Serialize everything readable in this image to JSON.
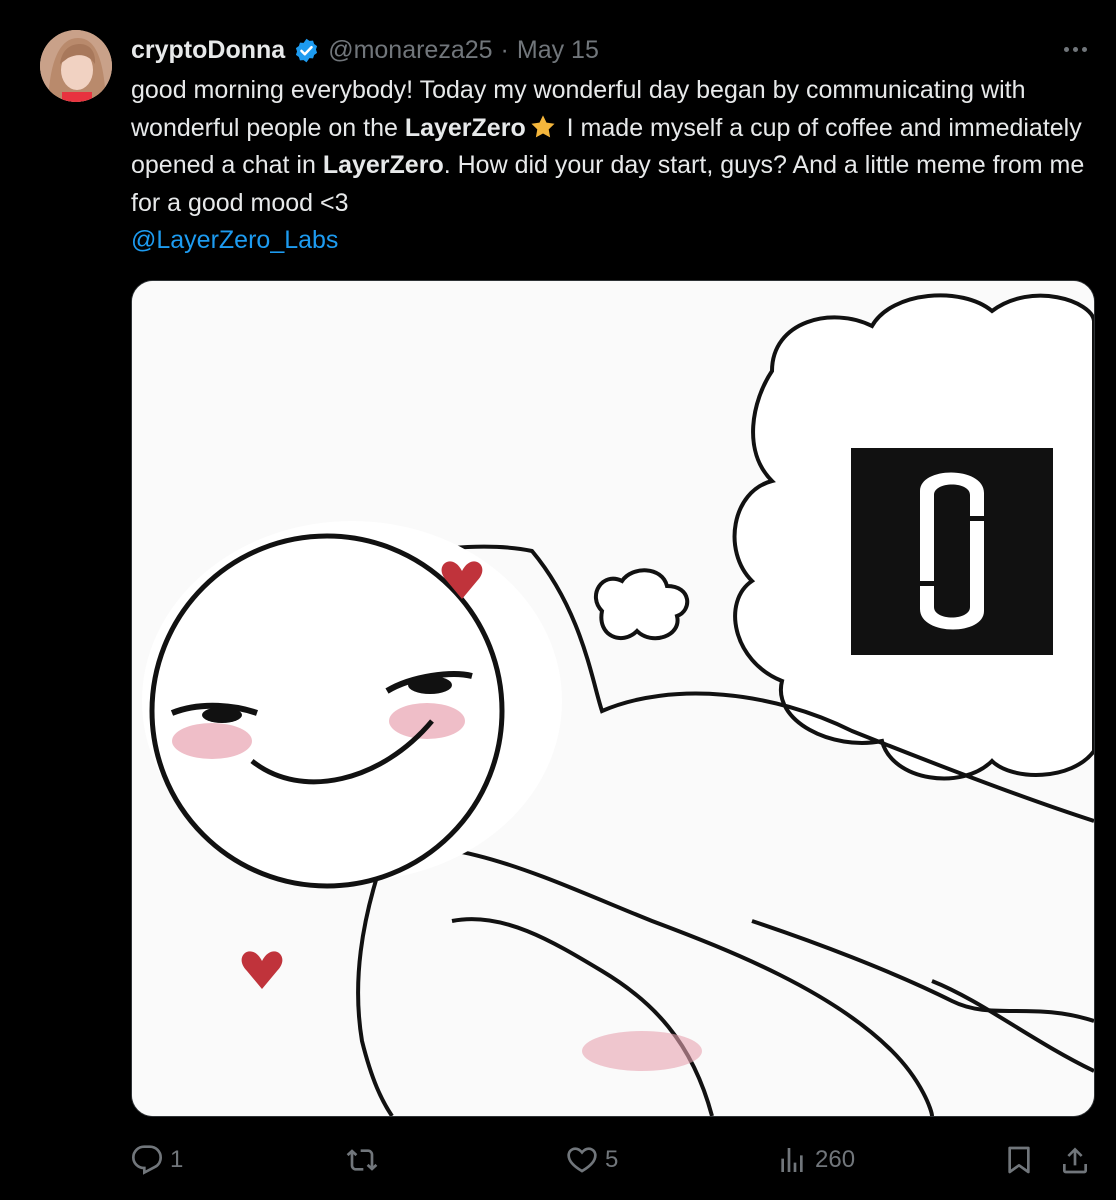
{
  "tweet": {
    "display_name": "cryptoDonna",
    "handle": "@monareza25",
    "separator": "·",
    "date": "May 15",
    "text": {
      "part1": "good morning everybody! Today my wonderful day began by communicating with wonderful people on the ",
      "bold1": "LayerZero",
      "part2": " I made myself a cup of coffee and immediately opened a chat in ",
      "bold2": "LayerZero",
      "part3": ". How did your day start, guys? And a little meme from me for a good mood <3",
      "mention": "@LayerZero_Labs"
    },
    "icons": {
      "verified": "verified-badge-icon",
      "star": "star-emoji-icon",
      "more": "more-options-icon"
    }
  },
  "media": {
    "description_icon": "layerzero-logo-icon"
  },
  "actions": {
    "reply_count": "1",
    "repost_count": "",
    "like_count": "5",
    "views_count": "260"
  },
  "colors": {
    "background": "#000000",
    "text": "#e7e9ea",
    "muted": "#71767b",
    "link": "#1d9bf0",
    "verified": "#1d9bf0"
  }
}
